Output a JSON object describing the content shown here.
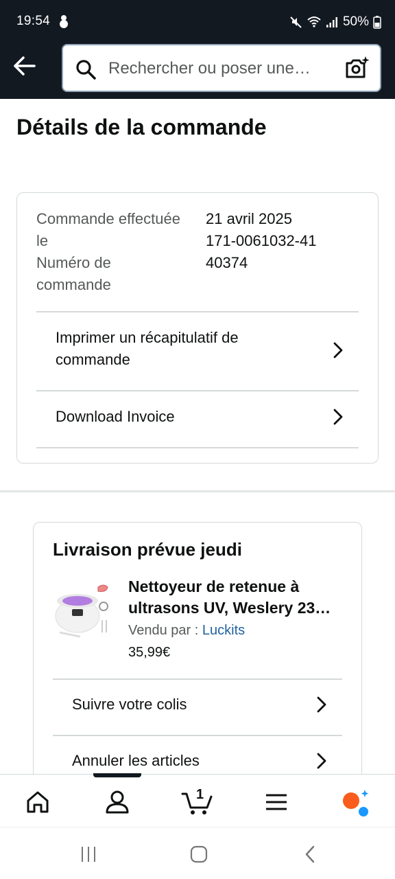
{
  "status_bar": {
    "time": "19:54",
    "battery": "50%",
    "left_icon": "snowman-notification-icon",
    "right_icons": [
      "mute-icon",
      "wifi-icon",
      "signal-icon",
      "battery-icon"
    ]
  },
  "header": {
    "search_placeholder": "Rechercher ou poser une…",
    "back_icon": "back-arrow-icon",
    "search_icon": "search-icon",
    "camera_icon": "camera-lens-icon"
  },
  "page": {
    "title": "Détails de la commande"
  },
  "order": {
    "date_label": "Commande effectuée le",
    "date_value": "21 avril 2025",
    "number_label": "Numéro de commande",
    "number_value": "171-0061032-4140374",
    "actions": [
      {
        "label": "Imprimer un récapitulatif de commande"
      },
      {
        "label": "Download Invoice"
      }
    ]
  },
  "delivery": {
    "title": "Livraison prévue jeudi",
    "product": {
      "title": "Nettoyeur de retenue à ultrasons UV, Weslery 23…",
      "sold_by_label": "Vendu par  : ",
      "seller": "Luckits",
      "price": "35,99€"
    },
    "actions": [
      {
        "label": "Suivre votre colis"
      },
      {
        "label": "Annuler les articles"
      }
    ]
  },
  "bottom_nav": {
    "cart_count": "1",
    "items": [
      "home-icon",
      "account-icon",
      "cart-icon",
      "menu-icon",
      "rufus-assistant-icon"
    ]
  },
  "colors": {
    "header_bg": "#131921",
    "link": "#2162a1",
    "text": "#0f1111",
    "secondary_text": "#565959",
    "assistant_orange": "#f95c1c",
    "assistant_blue": "#1a98ff"
  }
}
